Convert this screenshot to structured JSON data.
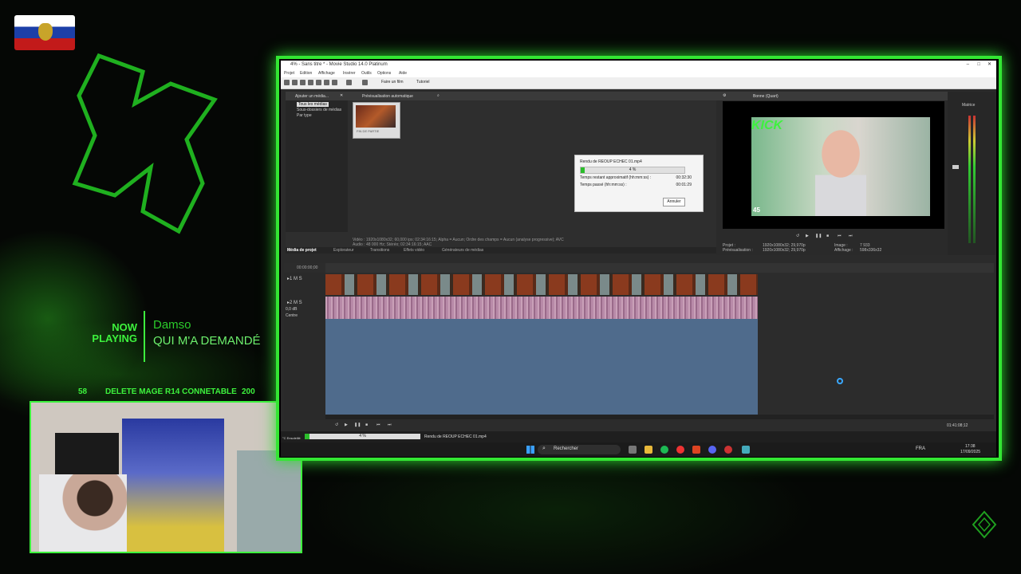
{
  "overlay": {
    "now_playing": "NOW PLAYING",
    "artist": "Damso",
    "song": "QUI M'A DEMANDÉ",
    "ticker": {
      "left_value": "58",
      "message": "DELETE MAGE R14 CONNETABLE",
      "right_value": "200"
    }
  },
  "window": {
    "title": "4% - Sans titre * - Movie Studio 14.0 Platinum",
    "menus": [
      "Projet",
      "Edition",
      "Affichage",
      "Insérer",
      "Outils",
      "Options",
      "Aide"
    ],
    "toolbar": {
      "make_movie": "Faire un film",
      "tutorial": "Tutoriel"
    }
  },
  "media_pane": {
    "add_media": "Ajouter un média...",
    "auto_preview": "Prévisualisation automatique",
    "tree": [
      "Tous les médias",
      "Sous-dossiers de médias",
      "Par type"
    ],
    "thumb_label": "FIN DE PARTIE",
    "info_line1": "Vidéo : 1920x1080x32; 60,000 ips; 02:34:16:15; Alpha = Aucun; Ordre des champs = Aucun (analyse progressive); AVC",
    "info_line2": "Audio : 48 000 Hz; Stéréo; 02:34:16:15; AAC",
    "tabs": [
      "Média de projet",
      "Explorateur",
      "Transitions",
      "Effets vidéo",
      "Générateurs de médias"
    ]
  },
  "render_dialog": {
    "title": "Rendu de REOUP ECHEC 01.mp4",
    "progress_label": "4 %",
    "progress": 4,
    "remaining_label": "Temps restant approximatif (hh:mm:ss) :",
    "remaining_value": "00:32:30",
    "elapsed_label": "Temps passé (hh:mm:ss) :",
    "elapsed_value": "00:01:29",
    "cancel": "Annuler"
  },
  "preview": {
    "quality": "Bonne (Quart)",
    "badge": "KICK",
    "viewers": "45",
    "project_label": "Projet :",
    "project_value": "1920x1080x32; 29,970p",
    "preview_label": "Prévisualisation :",
    "preview_value": "1920x1080x32; 29,970p",
    "image_label": "Image :",
    "image_value": "7 933",
    "display_label": "Affichage :",
    "display_value": "598x336x32"
  },
  "mixer": {
    "label": "Matrice"
  },
  "timeline": {
    "timecode": "00:00:00;00",
    "track2_vol": "0,0 dB",
    "track2_pan": "Centre",
    "end_time": "01:41:08;12"
  },
  "statusbar": {
    "progress_label": "4 %",
    "progress": 4,
    "render_text": "Rendu de REOUP ECHEC 01.mp4",
    "left_text": "°C Ensoleillé"
  },
  "taskbar": {
    "search": "Rechercher",
    "lang": "FRA",
    "time": "17:38",
    "date": "17/09/2025"
  },
  "colors": {
    "accent": "#33e633",
    "overlay_text": "#3df23d",
    "clip_blue": "#4f6b8c"
  }
}
